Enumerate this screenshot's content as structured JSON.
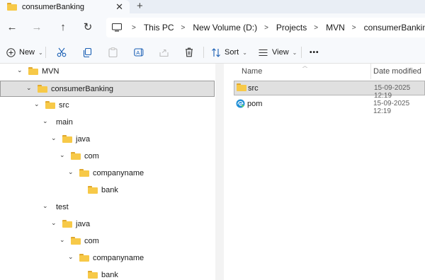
{
  "tab": {
    "title": "consumerBanking",
    "close": "✕",
    "new": "+"
  },
  "nav": {
    "back": "←",
    "forward": "→",
    "up": "↑",
    "refresh": "↻"
  },
  "breadcrumb": [
    "This PC",
    "New Volume (D:)",
    "Projects",
    "MVN",
    "consumerBanking"
  ],
  "toolbar": {
    "new_label": "New",
    "sort_label": "Sort",
    "view_label": "View",
    "more_label": "•••"
  },
  "tree": [
    {
      "label": "MVN",
      "indent": 1
    },
    {
      "label": "consumerBanking",
      "indent": 2,
      "selected": true
    },
    {
      "label": "src",
      "indent": 3
    },
    {
      "label": "main",
      "indent": 4,
      "noicon": true
    },
    {
      "label": "java",
      "indent": 5
    },
    {
      "label": "com",
      "indent": 6
    },
    {
      "label": "companyname",
      "indent": 7
    },
    {
      "label": "bank",
      "indent": 8,
      "leaf": true
    },
    {
      "label": "test",
      "indent": 4,
      "noicon": true
    },
    {
      "label": "java",
      "indent": 5
    },
    {
      "label": "com",
      "indent": 6
    },
    {
      "label": "companyname",
      "indent": 7
    },
    {
      "label": "bank",
      "indent": 8,
      "leaf": true
    }
  ],
  "columns": {
    "name": "Name",
    "date": "Date modified"
  },
  "files": [
    {
      "name": "src",
      "date": "15-09-2025 12:19",
      "type": "folder",
      "selected": true
    },
    {
      "name": "pom",
      "date": "15-09-2025 12:19",
      "type": "edge"
    }
  ],
  "colors": {
    "folder": "#f7c948",
    "selection": "#e0e0e0",
    "accent": "#0067c0"
  }
}
